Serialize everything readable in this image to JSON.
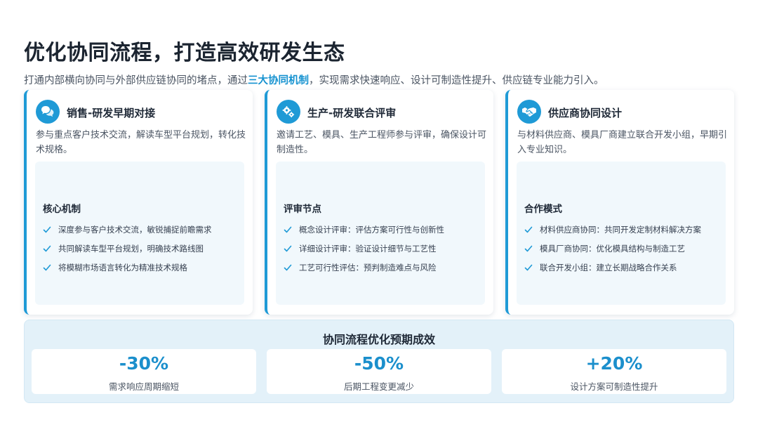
{
  "header": {
    "title": "优化协同流程，打造高效研发生态",
    "subtitle_pre": "打通内部横向协同与外部供应链协同的堵点，通过",
    "subtitle_highlight": "三大协同机制",
    "subtitle_post": "，实现需求快速响应、设计可制造性提升、供应链专业能力引入。"
  },
  "cards": [
    {
      "icon": "chat-bubbles-icon",
      "title": "销售-研发早期对接",
      "desc": "参与重点客户技术交流，解读车型平台规划，转化技术规格。",
      "inner_title": "核心机制",
      "items": [
        "深度参与客户技术交流，敏锐捕捉前瞻需求",
        "共同解读车型平台规划，明确技术路线图",
        "将模糊市场语言转化为精准技术规格"
      ]
    },
    {
      "icon": "gears-icon",
      "title": "生产-研发联合评审",
      "desc": "邀请工艺、模具、生产工程师参与评审，确保设计可制造性。",
      "inner_title": "评审节点",
      "items": [
        "概念设计评审：评估方案可行性与创新性",
        "详细设计评审：验证设计细节与工艺性",
        "工艺可行性评估：预判制造难点与风险"
      ]
    },
    {
      "icon": "handshake-icon",
      "title": "供应商协同设计",
      "desc": "与材料供应商、模具厂商建立联合开发小组，早期引入专业知识。",
      "inner_title": "合作模式",
      "items": [
        "材料供应商协同：共同开发定制材料解决方案",
        "模具厂商协同：优化模具结构与制造工艺",
        "联合开发小组：建立长期战略合作关系"
      ]
    }
  ],
  "results": {
    "title": "协同流程优化预期成效",
    "metrics": [
      {
        "value": "-30%",
        "label": "需求响应周期缩短"
      },
      {
        "value": "-50%",
        "label": "后期工程变更减少"
      },
      {
        "value": "+20%",
        "label": "设计方案可制造性提升"
      }
    ]
  },
  "colors": {
    "accent": "#1f9ad6",
    "metric_value": "#1b8fcc",
    "panel_bg": "#e3f1f9",
    "inner_bg": "#f1f8fc"
  }
}
